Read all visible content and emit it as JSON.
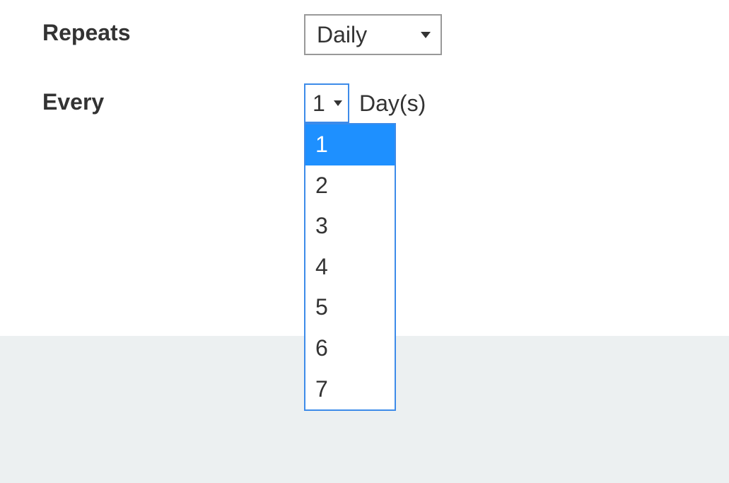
{
  "form": {
    "repeats": {
      "label": "Repeats",
      "value": "Daily"
    },
    "every": {
      "label": "Every",
      "value": "1",
      "unit": "Day(s)",
      "options": [
        "1",
        "2",
        "3",
        "4",
        "5",
        "6",
        "7"
      ],
      "selected_index": 0
    }
  }
}
